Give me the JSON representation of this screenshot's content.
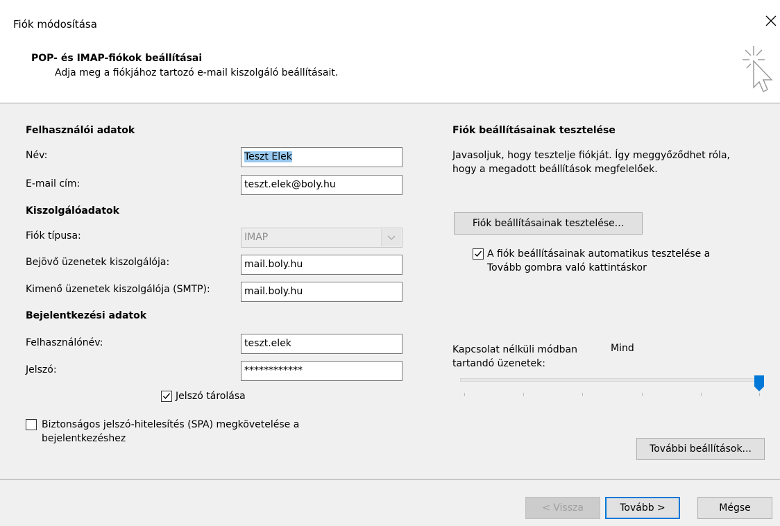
{
  "window": {
    "title": "Fiók módosítása"
  },
  "header": {
    "title": "POP- és IMAP-fiókok beállításai",
    "subtitle": "Adja meg a fiókjához tartozó e-mail kiszolgáló beállításait."
  },
  "user_info": {
    "section": "Felhasználói adatok",
    "name_label": "Név:",
    "name_value": "Teszt Elek",
    "email_label": "E-mail cím:",
    "email_value": "teszt.elek@boly.hu"
  },
  "server_info": {
    "section": "Kiszolgálóadatok",
    "account_type_label": "Fiók típusa:",
    "account_type_value": "IMAP",
    "incoming_label": "Bejövő üzenetek kiszolgálója:",
    "incoming_value": "mail.boly.hu",
    "outgoing_label": "Kimenő üzenetek kiszolgálója (SMTP):",
    "outgoing_value": "mail.boly.hu"
  },
  "login_info": {
    "section": "Bejelentkezési adatok",
    "username_label": "Felhasználónév:",
    "username_value": "teszt.elek",
    "password_label": "Jelszó:",
    "password_value": "************",
    "remember_password_label": "Jelszó tárolása",
    "remember_password_checked": true,
    "spa_label_line1": "Biztonságos jelszó-hitelesítés (SPA) megkövetelése a",
    "spa_label_line2": "bejelentkezéshez",
    "spa_checked": false
  },
  "test_settings": {
    "section": "Fiók beállításainak tesztelése",
    "description_line1": "Javasoljuk, hogy tesztelje fiókját. Így meggyőződhet róla,",
    "description_line2": "hogy a megadott beállítások megfelelőek.",
    "test_button": "Fiók beállításainak tesztelése...",
    "auto_test_line1": "A fiók beállításainak automatikus tesztelése a",
    "auto_test_line2": "Tovább gombra való kattintáskor",
    "auto_test_checked": true
  },
  "offline": {
    "label_line1": "Kapcsolat nélküli módban",
    "label_line2": "tartandó üzenetek:",
    "value": "Mind",
    "slider_level": 1.0
  },
  "buttons": {
    "more_settings": "További beállítások...",
    "back": "< Vissza",
    "next": "Tovább >",
    "cancel": "Mégse"
  },
  "colors": {
    "accent": "#0078d7",
    "selection": "#99c9ef"
  }
}
